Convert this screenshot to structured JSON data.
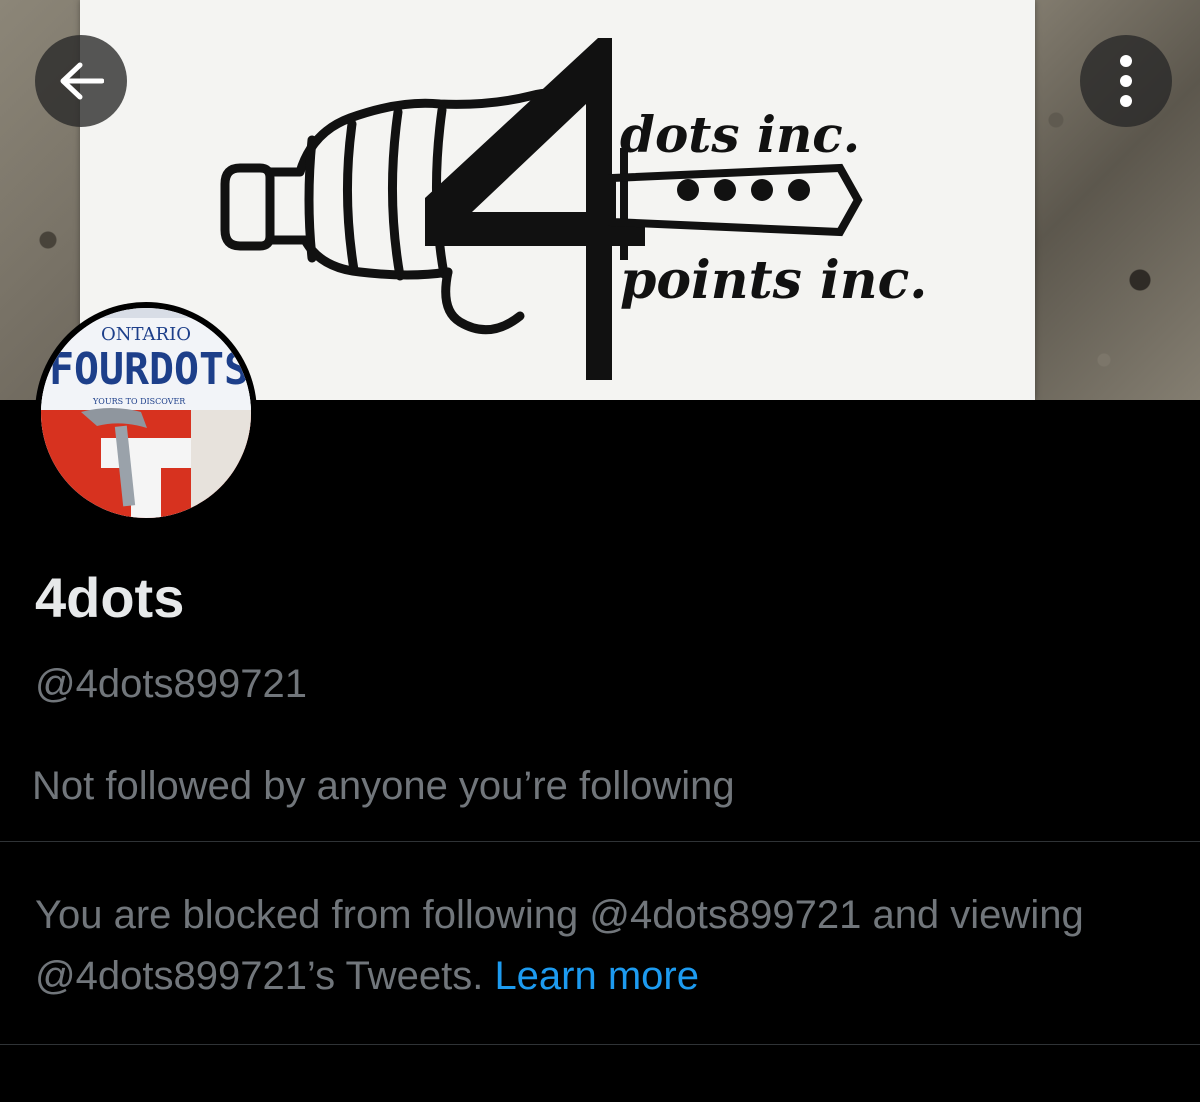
{
  "banner": {
    "logo_text_top": "dots inc.",
    "logo_text_bottom": "points inc."
  },
  "toolbar": {
    "back_icon": "arrow-left-icon",
    "more_icon": "more-vertical-icon"
  },
  "avatar": {
    "plate_region": "ONTARIO",
    "plate_number": "FOURDOTS",
    "plate_slogan": "YOURS TO DISCOVER"
  },
  "profile": {
    "display_name": "4dots",
    "handle": "@4dots899721",
    "followers_note": "Not followed by anyone you’re following"
  },
  "block_notice": {
    "text": "You are blocked from following @4dots899721 and viewing @4dots899721’s Tweets. ",
    "link_label": "Learn more",
    "link_color": "#1d9bf0"
  }
}
